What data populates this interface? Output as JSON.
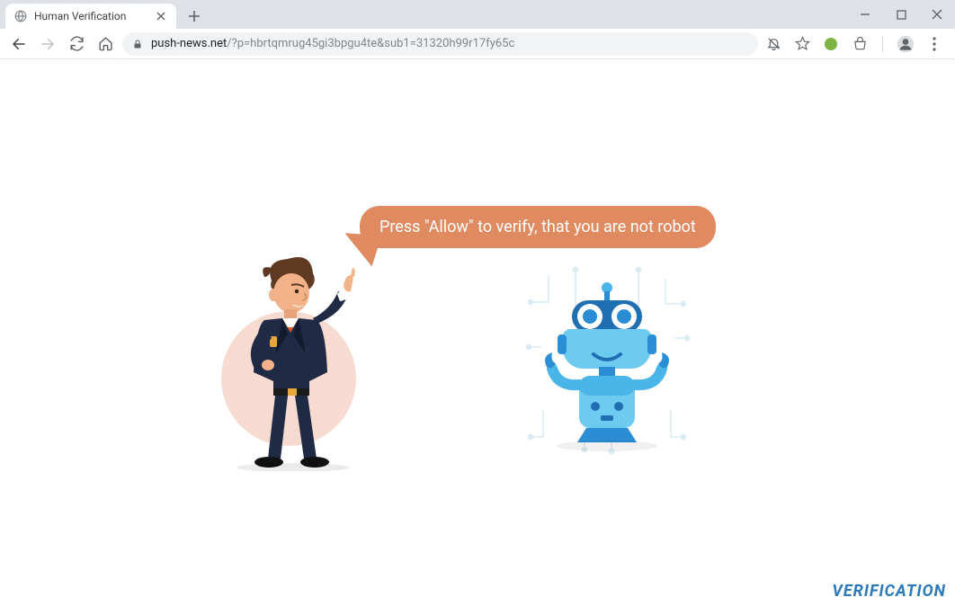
{
  "tab": {
    "title": "Human Verification"
  },
  "url": {
    "domain": "push-news.net",
    "path": "/?p=hbrtqmrug45gi3bpgu4te&sub1=31320h99r17fy65c"
  },
  "bubble": {
    "text": "Press \"Allow\" to verify, that you are not robot"
  },
  "footer": {
    "verification": "VERIFICATION"
  }
}
